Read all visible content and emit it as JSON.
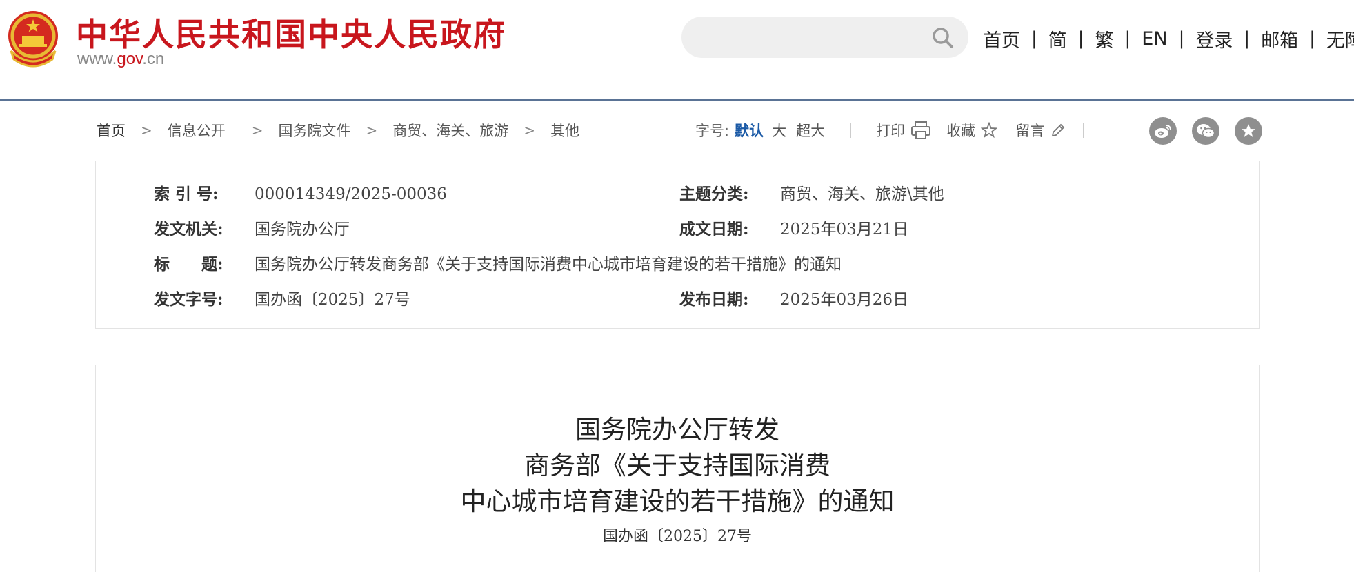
{
  "header": {
    "site_title": "中华人民共和国中央人民政府",
    "domain_prefix": "www.",
    "domain_mid": "gov",
    "domain_suffix": ".cn",
    "search_placeholder": "",
    "nav": [
      "首页",
      "简",
      "繁",
      "EN",
      "登录",
      "邮箱",
      "无障碍"
    ]
  },
  "breadcrumb": [
    "首页",
    "信息公开",
    "国务院文件",
    "商贸、海关、旅游",
    "其他"
  ],
  "tools": {
    "font_size_label": "字号:",
    "font_sizes": [
      "默认",
      "大",
      "超大"
    ],
    "active_font_size": "默认",
    "print": "打印",
    "favorite": "收藏",
    "comment": "留言"
  },
  "social_icons": [
    "weibo-icon",
    "wechat-icon",
    "favorites-star-icon"
  ],
  "meta": {
    "index_label": "索 引 号:",
    "index_value": "000014349/2025-00036",
    "topic_label": "主题分类:",
    "topic_value": "商贸、海关、旅游\\其他",
    "issuer_label": "发文机关:",
    "issuer_value": "国务院办公厅",
    "written_date_label": "成文日期:",
    "written_date_value": "2025年03月21日",
    "title_label": "标　　题:",
    "title_value": "国务院办公厅转发商务部《关于支持国际消费中心城市培育建设的若干措施》的通知",
    "doc_number_label": "发文字号:",
    "doc_number_value": "国办函〔2025〕27号",
    "publish_date_label": "发布日期:",
    "publish_date_value": "2025年03月26日"
  },
  "article": {
    "title_line1": "国务院办公厅转发",
    "title_line2": "商务部《关于支持国际消费",
    "title_line3": "中心城市培育建设的若干措施》的通知",
    "doc_number": "国办函〔2025〕27号"
  },
  "colors": {
    "brand_red": "#c8161d",
    "header_rule": "#5a7395",
    "active_link": "#1b5aa6",
    "social_grey": "#8f8f8f"
  }
}
